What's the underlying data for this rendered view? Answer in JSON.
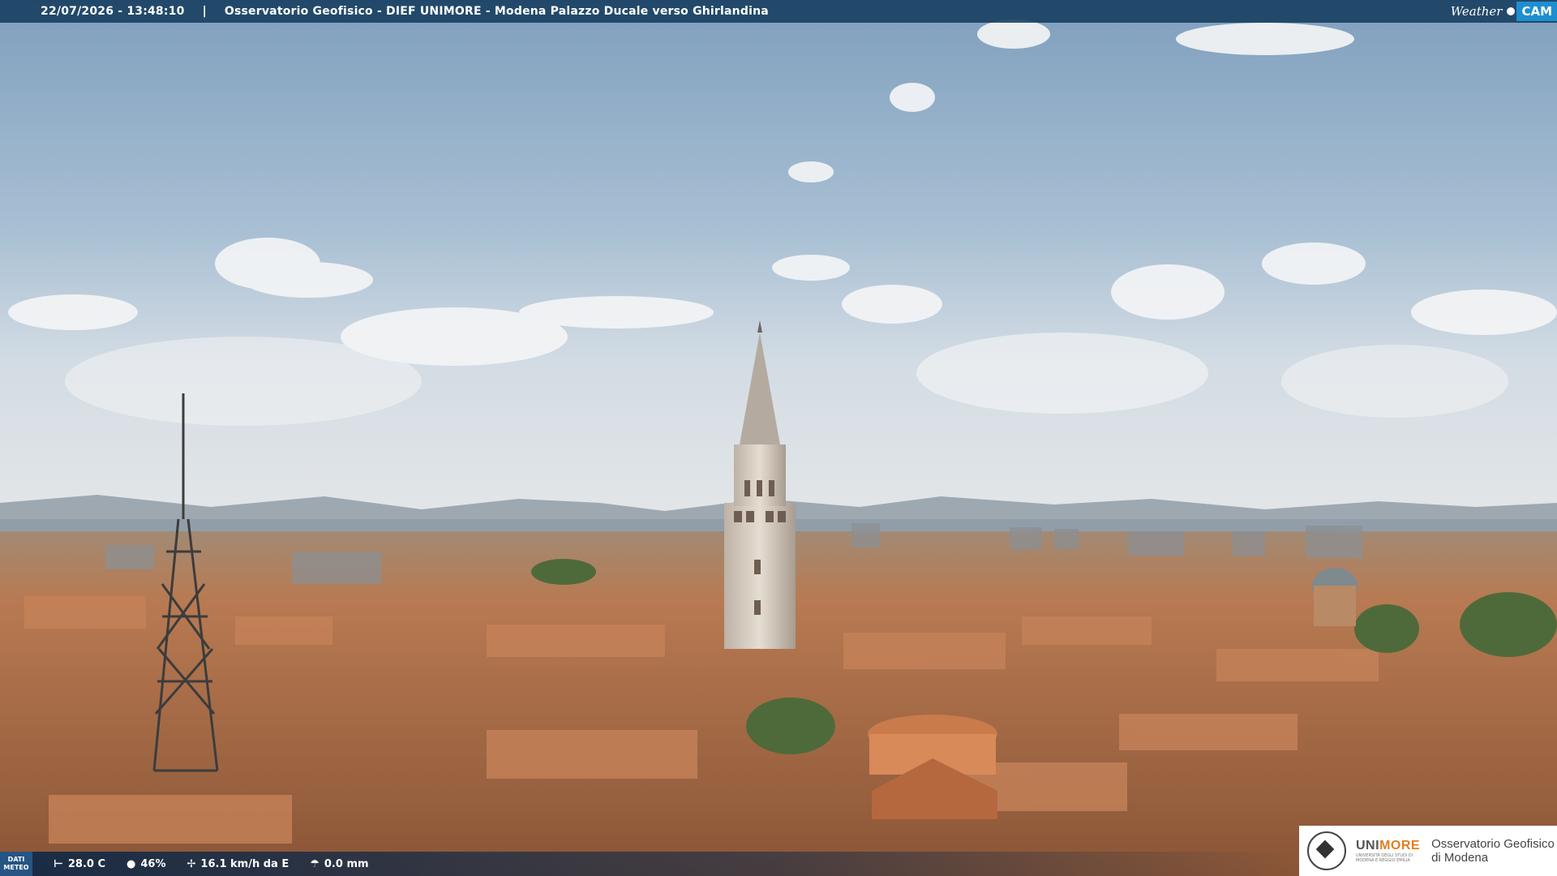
{
  "topbar": {
    "timestamp": "22/07/2026 - 13:48:10",
    "separator": "|",
    "caption": "Osservatorio Geofisico - DIEF UNIMORE - Modena Palazzo Ducale verso Ghirlandina",
    "brand_weather": "Weather",
    "brand_cam": "CAM"
  },
  "weather": {
    "label_line1": "DATI",
    "label_line2": "METEO",
    "temperature": "28.0 C",
    "humidity": "46%",
    "wind": "16.1 km/h da E",
    "rain": "0.0 mm",
    "icons": {
      "temperature": "thermometer-icon",
      "humidity": "humidity-icon",
      "wind": "wind-icon",
      "rain": "rain-icon"
    }
  },
  "logo": {
    "uni_a": "UNI",
    "uni_b": "MORE",
    "uni_sub1": "UNIVERSITÀ DEGLI STUDI DI",
    "uni_sub2": "MODENA E REGGIO EMILIA",
    "obs_line1": "Osservatorio Geofisico",
    "obs_line2": "di Modena"
  },
  "colors": {
    "bar": "#143c5f",
    "brand_blue": "#1d8fd1",
    "unimore_orange": "#e07f22",
    "roof": "#b8754a"
  }
}
